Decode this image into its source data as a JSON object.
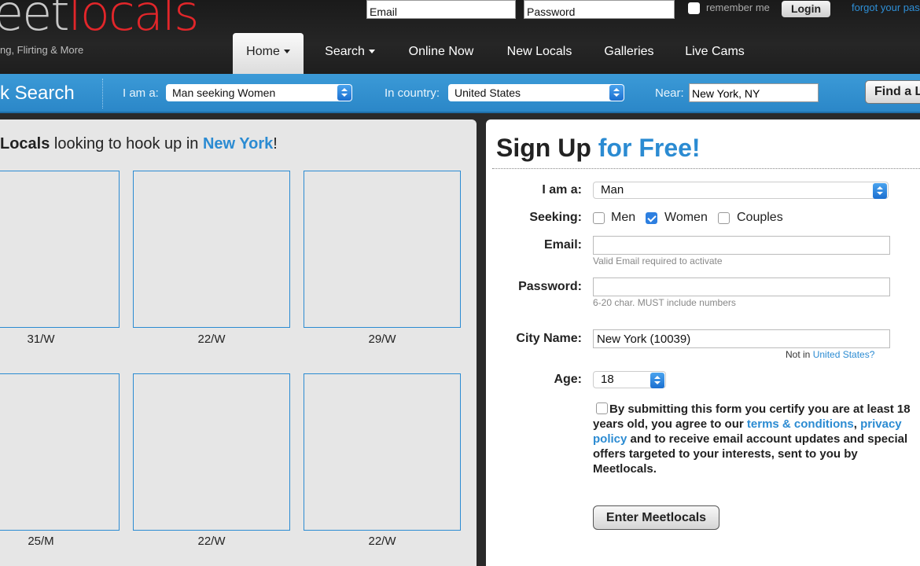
{
  "header": {
    "logo_part1": "eet",
    "logo_part2": "locals",
    "tagline": "ng, Flirting & More",
    "email_placeholder": "Email",
    "password_placeholder": "Password",
    "remember_label": "remember me",
    "login_label": "Login",
    "forgot_label": "forgot your pas"
  },
  "nav": {
    "items": [
      {
        "label": "Home"
      },
      {
        "label": "Search"
      },
      {
        "label": "Online Now"
      },
      {
        "label": "New Locals"
      },
      {
        "label": "Galleries"
      },
      {
        "label": "Live Cams"
      }
    ]
  },
  "search_bar": {
    "title": "k Search",
    "iam_label": "I am a:",
    "iam_value": "Man seeking Women",
    "country_label": "In country:",
    "country_value": "United States",
    "near_label": "Near:",
    "near_value": "New York, NY",
    "find_label": "Find a L"
  },
  "locals": {
    "title_bold": "Locals",
    "title_mid": " looking to hook up in ",
    "city": "New York",
    "title_end": "!",
    "profiles": [
      {
        "caption": "31/W",
        "colors": [
          "#8a5a36",
          "#c89a6a",
          "#3b2a1c"
        ]
      },
      {
        "caption": "22/W",
        "colors": [
          "#6f7058",
          "#9a9a80",
          "#d9c1a8"
        ]
      },
      {
        "caption": "29/W",
        "colors": [
          "#6b86c8",
          "#8a9ad0",
          "#3a2c22"
        ]
      },
      {
        "caption": "25/M",
        "colors": [
          "#3b6fa8",
          "#d29a70",
          "#f3f3f3"
        ]
      },
      {
        "caption": "22/W",
        "colors": [
          "#232323",
          "#d9b58a",
          "#6c7a3a"
        ]
      },
      {
        "caption": "22/W",
        "colors": [
          "#0c0c14",
          "#1d2233",
          "#8a6a58"
        ]
      }
    ]
  },
  "signup": {
    "title_a": "Sign Up",
    "title_b": " for Free!",
    "iam_label": "I am a:",
    "iam_value": "Man",
    "seeking_label": "Seeking:",
    "seek_men": "Men",
    "seek_women": "Women",
    "seek_couples": "Couples",
    "email_label": "Email:",
    "email_hint": "Valid Email required to activate",
    "password_label": "Password:",
    "password_hint": "6-20 char. MUST include numbers",
    "city_label": "City Name:",
    "city_value": "New York (10039)",
    "not_in": "Not in ",
    "not_in_link": "United States?",
    "age_label": "Age:",
    "age_value": "18",
    "terms_1": "By submitting this form you certify you are at least 18 years old, you agree to our ",
    "terms_link1": "terms & conditions",
    "terms_2": ", ",
    "terms_link2": "privacy policy",
    "terms_3": " and to receive email account updates and special offers targeted to your interests, sent to you by Meetlocals.",
    "enter_label": "Enter Meetlocals"
  }
}
